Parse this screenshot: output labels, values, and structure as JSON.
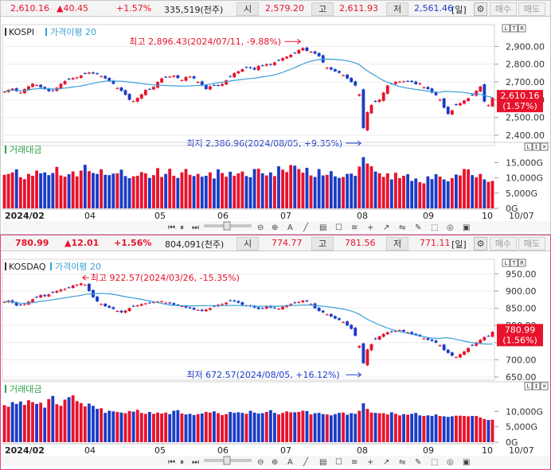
{
  "kospi": {
    "index": "2,610.16",
    "change": "▲40.45",
    "pct": "+1.57%",
    "volume": "335,519(천주)",
    "open_label": "시",
    "open": "2,579.20",
    "high_label": "고",
    "high": "2,611.93",
    "low_label": "저",
    "low": "2,561.46",
    "period": "[일]",
    "buy": "매수",
    "sell": "매도",
    "name": "KOSPI",
    "ma_label": "가격이평 20",
    "vol_title": "거래대금",
    "price_tag": "2,610.16",
    "pct_tag": "(1.57%)",
    "max_note": "최고 2,896.43(2024/07/11, -9.88%)",
    "min_note": "최저 2,386.96(2024/08/05, +9.35%)",
    "y_ticks": [
      "2,900.00",
      "2,800.00",
      "2,700.00",
      "2,600.00",
      "2,500.00",
      "2,400.00"
    ],
    "vol_ticks": [
      "15,000G",
      "10,000G",
      "5,000G",
      "0G"
    ],
    "x_labels": [
      "2024/02",
      "04",
      "05",
      "06",
      "07",
      "08",
      "09",
      "10",
      "10/07"
    ]
  },
  "kosdaq": {
    "index": "780.99",
    "change": "▲12.01",
    "pct": "+1.56%",
    "volume": "804,091(천주)",
    "open_label": "시",
    "open": "774.77",
    "high_label": "고",
    "high": "781.56",
    "low_label": "저",
    "low": "771.11",
    "period": "[일]",
    "buy": "매수",
    "sell": "매도",
    "name": "KOSDAQ",
    "ma_label": "가격이평 20",
    "vol_title": "거래대금",
    "price_tag": "780.99",
    "pct_tag": "(1.56%)",
    "max_note": "최고 922.57(2024/03/26, -15.35%)",
    "min_note": "최저 672.57(2024/08/05, +16.12%)",
    "y_ticks": [
      "950.00",
      "900.00",
      "850.00",
      "800.00",
      "750.00",
      "700.00",
      "650.00"
    ],
    "vol_ticks": [
      "10,000G",
      "5,000G",
      "0G"
    ],
    "x_labels": [
      "2024/02",
      "04",
      "05",
      "06",
      "07",
      "08",
      "09",
      "10",
      "10/07"
    ]
  },
  "colors": {
    "up": "#e8122c",
    "down": "#1b3cc8",
    "ma": "#3aa0d8"
  },
  "chart_data": [
    {
      "type": "candlestick",
      "title": "KOSPI",
      "ylim": [
        2360,
        2960
      ],
      "ma_window": 20,
      "annotations": [
        {
          "text": "최고 2,896.43(2024/07/11, -9.88%)",
          "value": 2896.43
        },
        {
          "text": "최저 2,386.96(2024/08/05, +9.35%)",
          "value": 2386.96
        }
      ],
      "close": [
        2645,
        2655,
        2662,
        2648,
        2640,
        2660,
        2675,
        2690,
        2682,
        2670,
        2660,
        2648,
        2652,
        2667,
        2690,
        2705,
        2716,
        2722,
        2725,
        2736,
        2748,
        2753,
        2748,
        2745,
        2732,
        2720,
        2705,
        2690,
        2666,
        2650,
        2628,
        2600,
        2592,
        2610,
        2630,
        2655,
        2660,
        2672,
        2700,
        2720,
        2728,
        2730,
        2735,
        2722,
        2710,
        2728,
        2730,
        2720,
        2700,
        2680,
        2660,
        2676,
        2682,
        2680,
        2689,
        2709,
        2730,
        2750,
        2760,
        2771,
        2782,
        2778,
        2770,
        2790,
        2793,
        2800,
        2797,
        2810,
        2822,
        2834,
        2842,
        2853,
        2863,
        2880,
        2891,
        2875,
        2870,
        2860,
        2845,
        2810,
        2780,
        2770,
        2760,
        2752,
        2738,
        2720,
        2700,
        2680,
        2630,
        2441,
        2530,
        2570,
        2590,
        2600,
        2640,
        2680,
        2690,
        2700,
        2701,
        2703,
        2705,
        2700,
        2688,
        2692,
        2670,
        2660,
        2640,
        2626,
        2600,
        2555,
        2520,
        2540,
        2570,
        2580,
        2595,
        2608,
        2626,
        2650,
        2674,
        2590,
        2569,
        2610
      ],
      "volume_g": [
        11000,
        11300,
        11800,
        12800,
        10200,
        9600,
        11300,
        10700,
        12400,
        11500,
        11800,
        10900,
        11600,
        13600,
        10800,
        10400,
        11200,
        12100,
        10500,
        12400,
        14300,
        12200,
        11600,
        11300,
        12800,
        11000,
        10900,
        11400,
        11500,
        12700,
        10600,
        9900,
        10500,
        10700,
        11900,
        11500,
        10000,
        10900,
        13200,
        10300,
        11300,
        13000,
        10700,
        10000,
        11800,
        12900,
        11000,
        10600,
        11300,
        10400,
        10700,
        11800,
        9800,
        12800,
        11600,
        10400,
        12000,
        10700,
        11500,
        12100,
        10600,
        10200,
        12900,
        13000,
        11500,
        10800,
        11800,
        10600,
        13800,
        12700,
        11900,
        14200,
        14000,
        12900,
        11700,
        13300,
        10800,
        10300,
        12900,
        10800,
        11000,
        12200,
        10500,
        10000,
        10300,
        11300,
        11400,
        10700,
        13700,
        16800,
        14700,
        13800,
        12100,
        11500,
        10300,
        11500,
        9500,
        11700,
        9900,
        10700,
        11200,
        9000,
        9800,
        8600,
        8200,
        10500,
        9600,
        11200,
        10400,
        9500,
        8900,
        9900,
        11100,
        10800,
        12900,
        12800,
        10900,
        10200,
        11300,
        9500,
        8700,
        9000
      ]
    },
    {
      "type": "candlestick",
      "title": "KOSDAQ",
      "ylim": [
        650,
        960
      ],
      "ma_window": 20,
      "annotations": [
        {
          "text": "최고 922.57(2024/03/26, -15.35%)",
          "value": 922.57
        },
        {
          "text": "최저 672.57(2024/08/05, +16.12%)",
          "value": 672.57
        }
      ],
      "close": [
        868,
        872,
        866,
        858,
        860,
        862,
        869,
        876,
        882,
        888,
        885,
        890,
        896,
        900,
        904,
        906,
        910,
        916,
        918,
        922,
        918,
        900,
        882,
        870,
        862,
        856,
        852,
        848,
        842,
        838,
        843,
        850,
        856,
        858,
        862,
        864,
        866,
        868,
        869,
        870,
        866,
        864,
        860,
        858,
        856,
        852,
        850,
        846,
        845,
        842,
        846,
        850,
        856,
        860,
        862,
        866,
        872,
        870,
        866,
        860,
        858,
        856,
        852,
        848,
        850,
        856,
        852,
        850,
        848,
        854,
        858,
        862,
        866,
        868,
        872,
        870,
        862,
        850,
        842,
        838,
        832,
        826,
        820,
        816,
        810,
        800,
        790,
        770,
        740,
        690,
        730,
        745,
        760,
        768,
        775,
        780,
        782,
        784,
        786,
        782,
        780,
        775,
        772,
        768,
        762,
        758,
        755,
        750,
        742,
        728,
        720,
        712,
        708,
        716,
        724,
        734,
        742,
        750,
        758,
        766,
        769,
        781
      ],
      "volume_g": [
        12000,
        11500,
        13000,
        12400,
        13200,
        12100,
        13600,
        13000,
        12400,
        12800,
        11200,
        14000,
        15000,
        12300,
        11800,
        13800,
        14600,
        15200,
        13300,
        12700,
        11600,
        12500,
        11800,
        10800,
        11000,
        9500,
        10200,
        10000,
        9800,
        9600,
        9400,
        10100,
        9900,
        10500,
        9500,
        9200,
        9800,
        9200,
        9600,
        9300,
        9600,
        9100,
        10200,
        10400,
        9300,
        9000,
        9200,
        8800,
        9100,
        9300,
        9800,
        9600,
        10000,
        9400,
        8800,
        9100,
        9800,
        9500,
        9700,
        9500,
        9200,
        10200,
        9600,
        9300,
        9400,
        9800,
        10400,
        9500,
        9000,
        9500,
        10000,
        9700,
        9700,
        9800,
        10200,
        10100,
        9000,
        9400,
        9500,
        9100,
        9000,
        8700,
        9100,
        9500,
        9600,
        8900,
        9400,
        9200,
        10200,
        12600,
        10800,
        9600,
        9500,
        9400,
        9400,
        9000,
        9700,
        9200,
        8700,
        9100,
        8900,
        9200,
        9500,
        8700,
        8500,
        8700,
        8500,
        9000,
        8500,
        8400,
        8200,
        8400,
        8600,
        8600,
        8500,
        8400,
        8500,
        8500,
        8000,
        7500,
        7200,
        7300
      ]
    }
  ]
}
